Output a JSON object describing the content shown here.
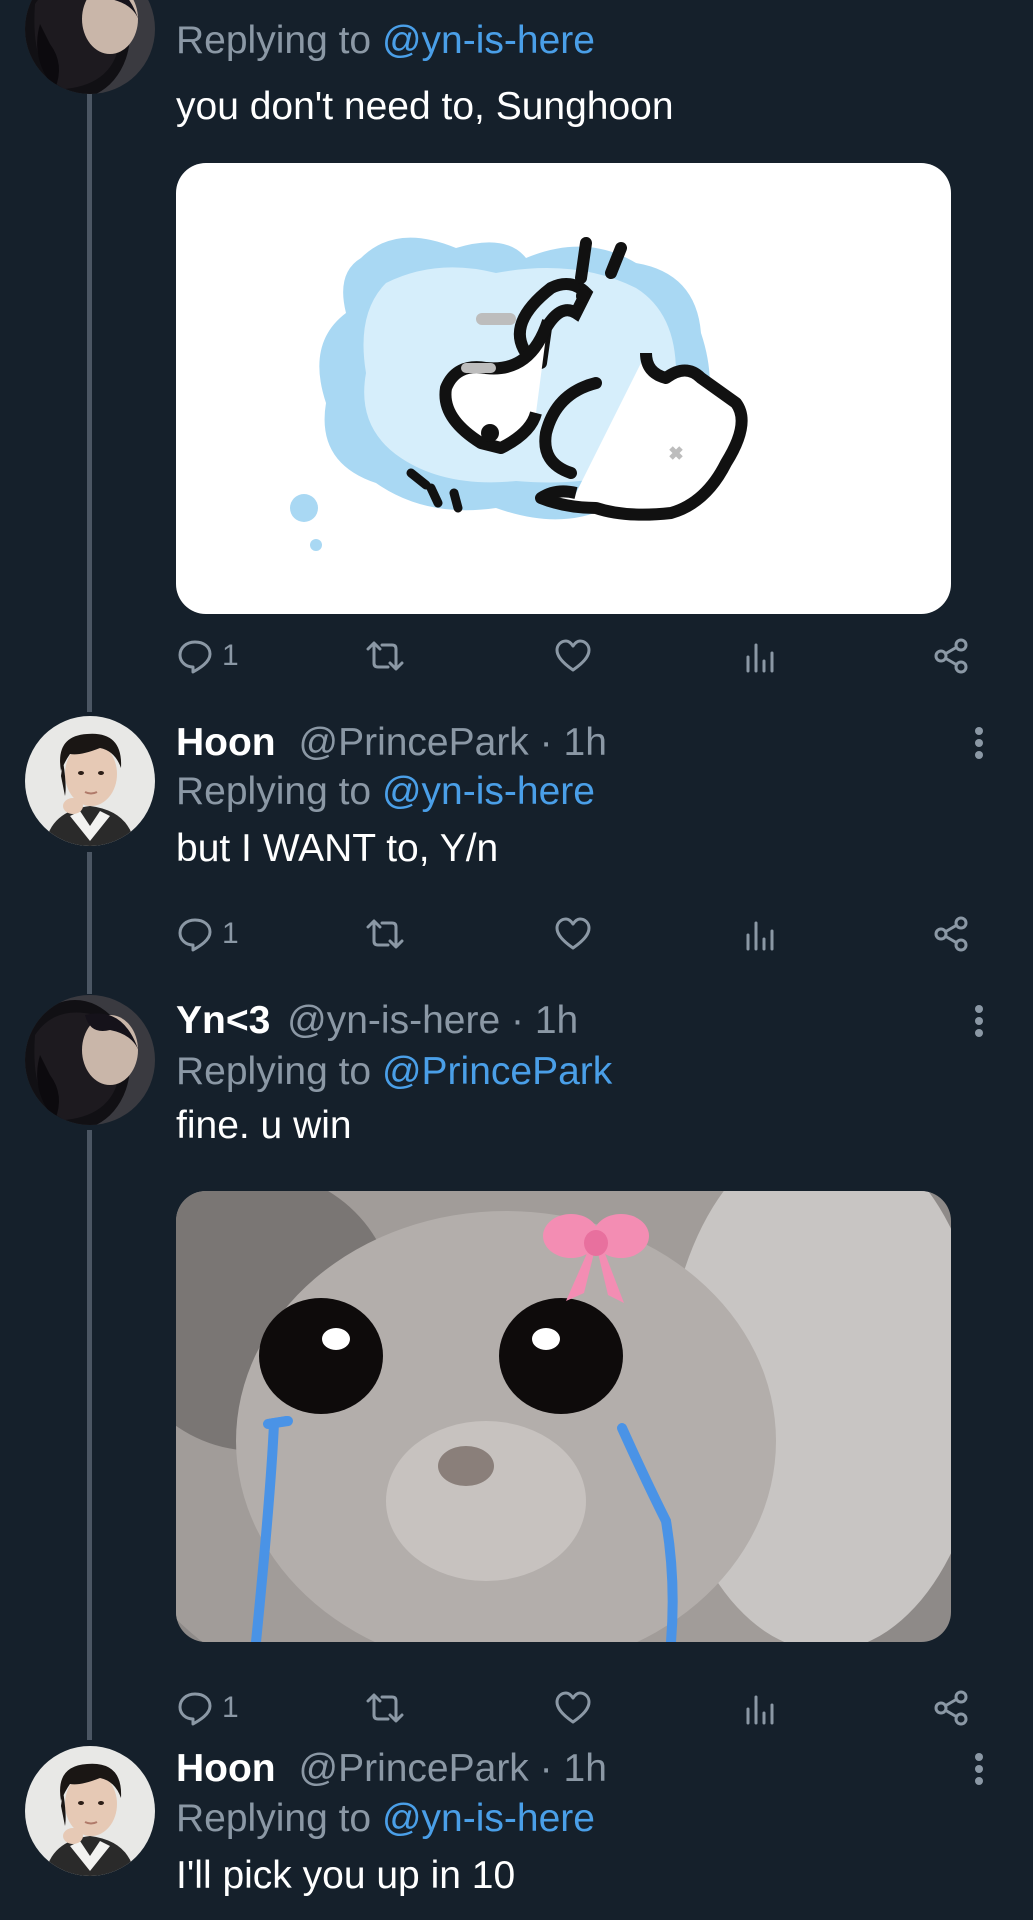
{
  "theme": {
    "background": "#15202b",
    "text": "#ffffff",
    "muted": "#8b98a5",
    "mention": "#4a9fe8",
    "thread_line": "#4b5663"
  },
  "tweets": [
    {
      "reply_prefix": "Replying to ",
      "reply_to": "@yn-is-here",
      "text": "you don't need to, Sunghoon",
      "media": "cartoon-crying-cat-sticker",
      "reply_count": "1",
      "avatar": "yn-avatar"
    },
    {
      "name": "Hoon",
      "handle": "@PrincePark",
      "separator": "·",
      "time": "1h",
      "reply_prefix": "Replying to ",
      "reply_to": "@yn-is-here",
      "text": "but I WANT to, Y/n",
      "reply_count": "1",
      "avatar": "hoon-avatar"
    },
    {
      "name": "Yn<3",
      "handle": "@yn-is-here",
      "separator": "·",
      "time": "1h",
      "reply_prefix": "Replying to ",
      "reply_to": "@PrincePark",
      "text": "fine. u win",
      "media": "crying-hamster-with-bow",
      "reply_count": "1",
      "avatar": "yn-avatar"
    },
    {
      "name": "Hoon",
      "handle": "@PrincePark",
      "separator": "·",
      "time": "1h",
      "reply_prefix": "Replying to ",
      "reply_to": "@yn-is-here",
      "text": "I'll pick you up in 10",
      "avatar": "hoon-avatar"
    }
  ],
  "icons": {
    "reply": "reply-icon",
    "retweet": "retweet-icon",
    "like": "heart-icon",
    "views": "views-icon",
    "share": "share-icon",
    "more": "more-icon"
  }
}
